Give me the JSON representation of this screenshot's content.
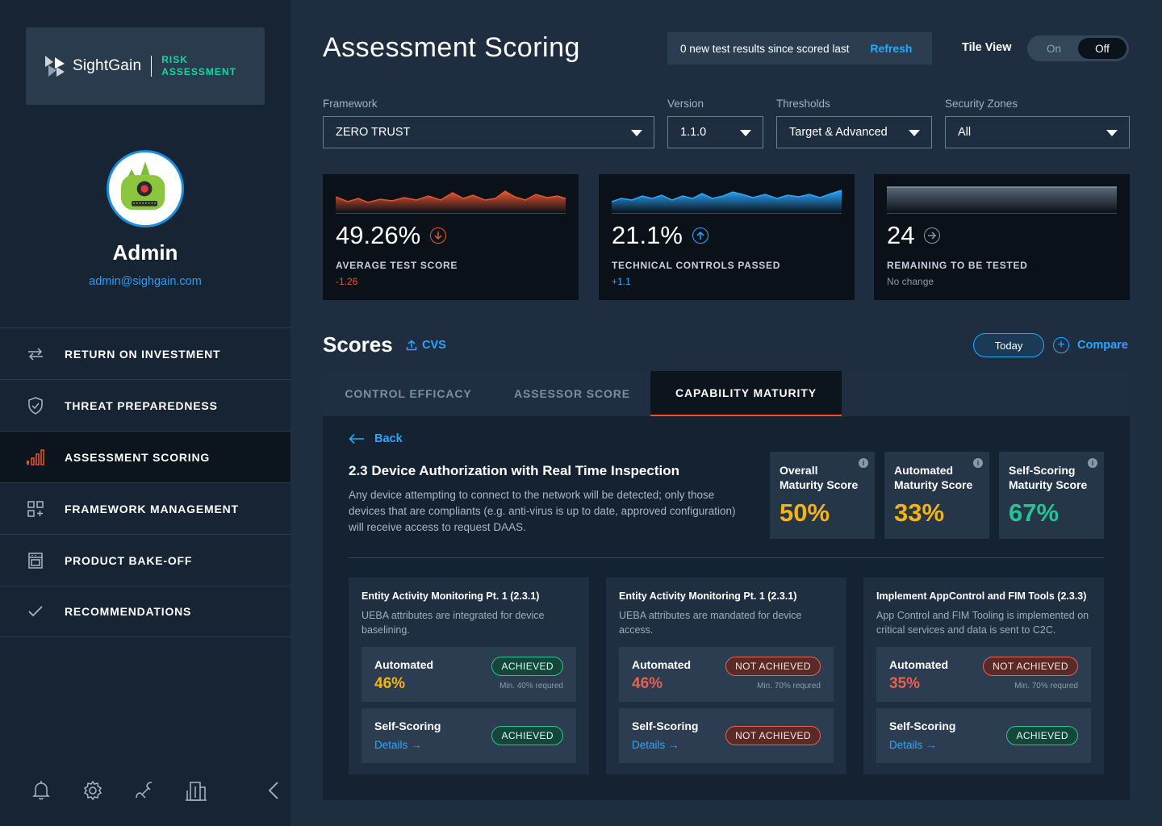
{
  "brand": {
    "name": "SightGain",
    "product_line1": "RISK",
    "product_line2": "ASSESSMENT",
    "accent": "#19d4a3"
  },
  "user": {
    "name": "Admin",
    "email": "admin@sighgain.com"
  },
  "nav": [
    {
      "label": "RETURN ON INVESTMENT",
      "icon": "transfer-arrows-icon"
    },
    {
      "label": "THREAT PREPAREDNESS",
      "icon": "shield-check-icon"
    },
    {
      "label": "ASSESSMENT SCORING",
      "icon": "signal-bars-icon",
      "active": true
    },
    {
      "label": "FRAMEWORK MANAGEMENT",
      "icon": "grid-plus-icon"
    },
    {
      "label": "PRODUCT BAKE-OFF",
      "icon": "oven-icon"
    },
    {
      "label": "RECOMMENDATIONS",
      "icon": "checkmark-icon"
    }
  ],
  "header": {
    "title": "Assessment Scoring",
    "notice": "0 new test results since scored last",
    "refresh": "Refresh",
    "tile_view_label": "Tile View",
    "toggle_on": "On",
    "toggle_off": "Off"
  },
  "filters": {
    "framework": {
      "label": "Framework",
      "value": "ZERO TRUST"
    },
    "version": {
      "label": "Version",
      "value": "1.1.0"
    },
    "thresholds": {
      "label": "Thresholds",
      "value": "Target & Advanced"
    },
    "zones": {
      "label": "Security Zones",
      "value": "All"
    }
  },
  "kpis": [
    {
      "value": "49.26%",
      "label": "AVERAGE TEST SCORE",
      "delta": "-1.26",
      "trend": "down",
      "color": "#e8542e"
    },
    {
      "value": "21.1%",
      "label": "TECHNICAL CONTROLS PASSED",
      "delta": "+1.1",
      "trend": "up",
      "color": "#2aa8ff"
    },
    {
      "value": "24",
      "label": "REMAINING TO BE TESTED",
      "delta": "No change",
      "trend": "flat",
      "color": "#8a98a8"
    }
  ],
  "scores": {
    "title": "Scores",
    "export": "CVS",
    "today": "Today",
    "compare": "Compare",
    "tabs": [
      "CONTROL EFFICACY",
      "ASSESSOR SCORE",
      "CAPABILITY MATURITY"
    ]
  },
  "detail": {
    "back": "Back",
    "title": "2.3 Device Authorization with Real Time Inspection",
    "description": "Any device attempting to connect to the network will be detected; only those devices that are compliants (e.g. anti-virus is up to date, approved configuration) will receive access to request DAAS.",
    "maturity": [
      {
        "label1": "Overall",
        "label2": "Maturity Score",
        "value": "50%",
        "color": "#f5b40f"
      },
      {
        "label1": "Automated",
        "label2": "Maturity Score",
        "value": "33%",
        "color": "#f5b40f"
      },
      {
        "label1": "Self-Scoring",
        "label2": "Maturity Score",
        "value": "67%",
        "color": "#23c594"
      }
    ],
    "controls": [
      {
        "title": "Entity Activity Monitoring Pt. 1 (2.3.1)",
        "description": "UEBA attributes are integrated for device baselining.",
        "automated_label": "Automated",
        "automated_value": "46%",
        "automated_color": "#f5b40f",
        "automated_status": "ACHIEVED",
        "automated_min": "Min. 40% requred",
        "self_label": "Self-Scoring",
        "self_link": "Details →",
        "self_status": "ACHIEVED"
      },
      {
        "title": "Entity Activity Monitoring Pt. 1 (2.3.1)",
        "description": "UEBA attributes are mandated for device access.",
        "automated_label": "Automated",
        "automated_value": "46%",
        "automated_color": "#e8604e",
        "automated_status": "NOT ACHIEVED",
        "automated_min": "Min. 70% requred",
        "self_label": "Self-Scoring",
        "self_link": "Details →",
        "self_status": "NOT ACHIEVED"
      },
      {
        "title": "Implement AppControl and FIM Tools (2.3.3)",
        "description": "App Control and FIM Tooling is implemented on critical services and data is sent to C2C.",
        "automated_label": "Automated",
        "automated_value": "35%",
        "automated_color": "#e8604e",
        "automated_status": "NOT ACHIEVED",
        "automated_min": "Min. 70% requred",
        "self_label": "Self-Scoring",
        "self_link": "Details →",
        "self_status": "ACHIEVED"
      }
    ]
  }
}
